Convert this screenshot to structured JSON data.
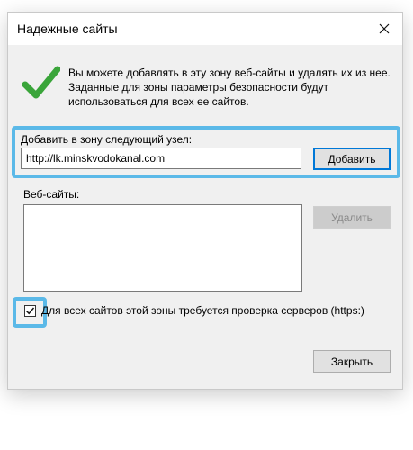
{
  "window": {
    "title": "Надежные сайты",
    "close_icon": "close-icon"
  },
  "description": "Вы можете добавлять в эту зону  веб-сайты и удалять их из нее. Заданные для зоны параметры безопасности будут использоваться для всех ее сайтов.",
  "add_section": {
    "label": "Добавить в зону следующий узел:",
    "input_value": "http://lk.minskvodokanal.com",
    "add_button": "Добавить"
  },
  "websites": {
    "label": "Веб-сайты:",
    "items": [],
    "remove_button": "Удалить"
  },
  "https_check": {
    "checked": true,
    "label": "Для всех сайтов этой зоны требуется проверка серверов (https:)"
  },
  "close_button": "Закрыть",
  "colors": {
    "highlight": "#5bb9e8",
    "check_green": "#3aa53a",
    "focus_blue": "#0078d7"
  }
}
